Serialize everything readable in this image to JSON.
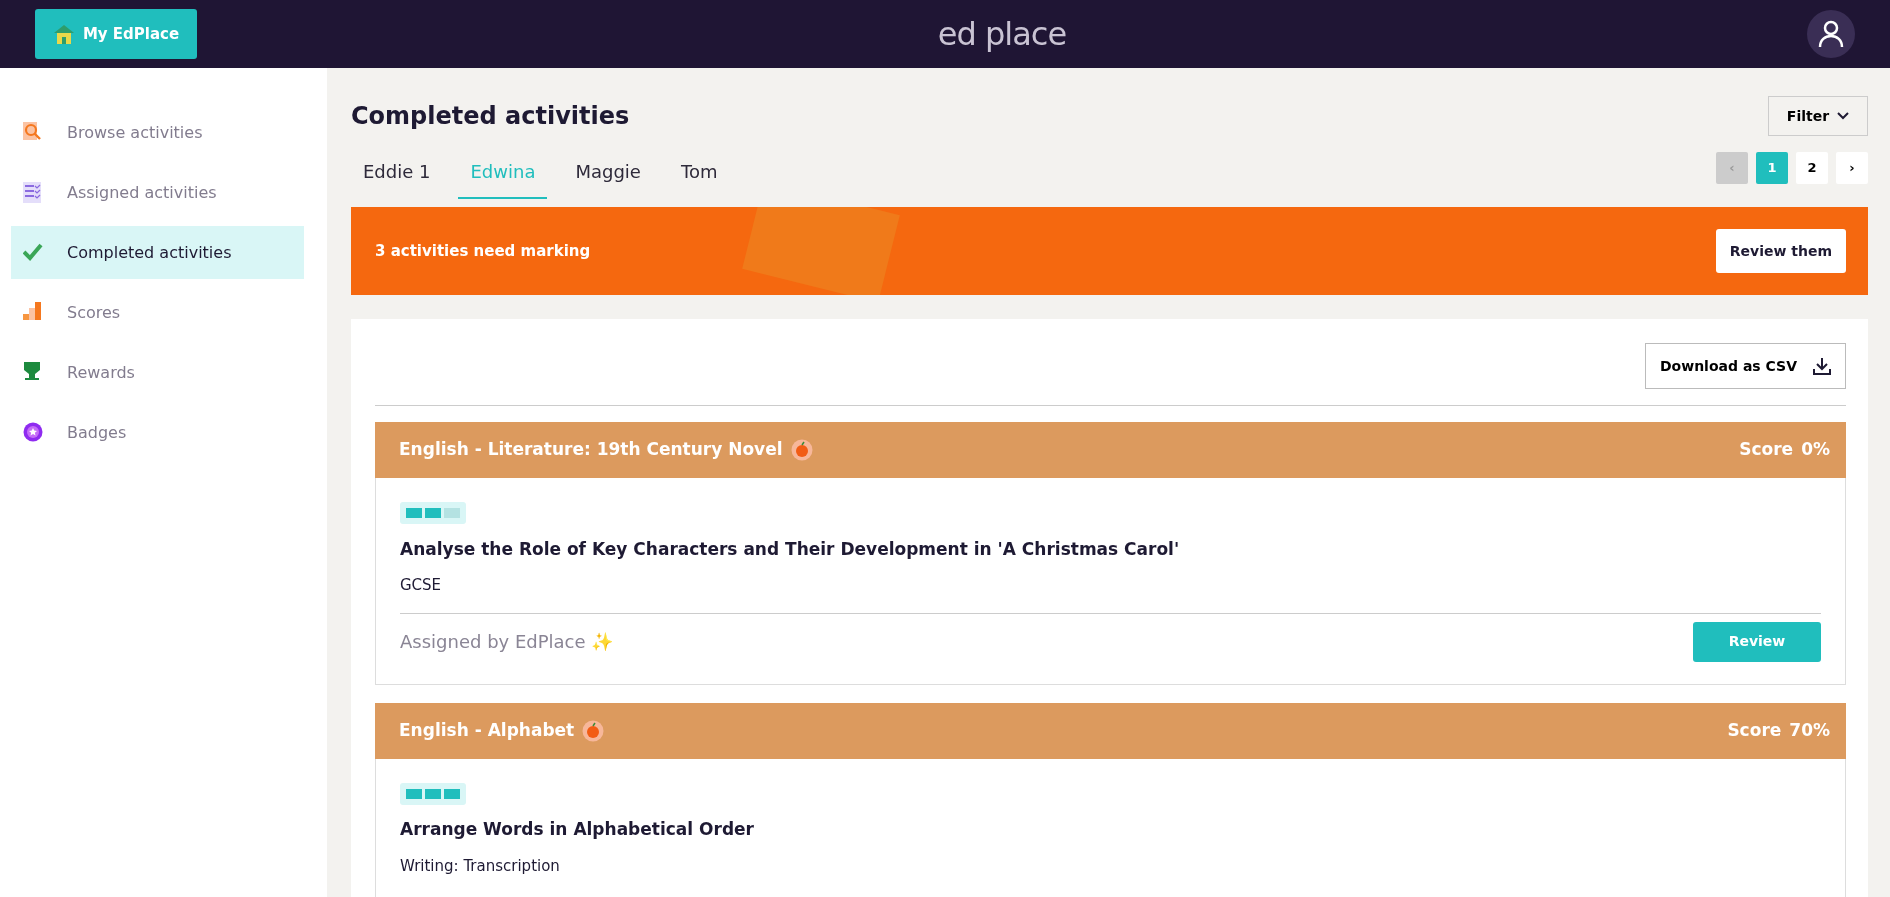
{
  "header": {
    "home_button": "My EdPlace",
    "logo": "ed place"
  },
  "sidebar": {
    "items": [
      {
        "label": "Browse activities",
        "kind": "search",
        "selected": false
      },
      {
        "label": "Assigned activities",
        "kind": "list",
        "selected": false
      },
      {
        "label": "Completed activities",
        "kind": "check",
        "selected": true
      },
      {
        "label": "Scores",
        "kind": "bars",
        "selected": false
      },
      {
        "label": "Rewards",
        "kind": "trophy",
        "selected": false
      },
      {
        "label": "Badges",
        "kind": "badge",
        "selected": false
      }
    ]
  },
  "page": {
    "title": "Completed activities",
    "filter_button": "Filter"
  },
  "tabs": [
    {
      "label": "Eddie 1",
      "selected": false
    },
    {
      "label": "Edwina",
      "selected": true
    },
    {
      "label": "Maggie",
      "selected": false
    },
    {
      "label": "Tom",
      "selected": false
    }
  ],
  "pagination": {
    "prev": "‹",
    "pages": [
      {
        "label": "1",
        "selected": true
      },
      {
        "label": "2",
        "selected": false
      }
    ],
    "next": "›"
  },
  "banner": {
    "text": "3 activities need marking",
    "button": "Review them"
  },
  "download_button": "Download as CSV",
  "activities": [
    {
      "subject": "English - Literature: 19th Century Novel",
      "score_label": "Score",
      "score": "0%",
      "stars": 2,
      "title": "Analyse the Role of Key Characters and Their Development in 'A Christmas Carol'",
      "level": "GCSE",
      "assigned_by": "Assigned by EdPlace ✨",
      "button": "Review"
    },
    {
      "subject": "English - Alphabet",
      "score_label": "Score",
      "score": "70%",
      "stars": 3,
      "title": "Arrange Words in Alphabetical Order",
      "level": "Writing: Transcription"
    }
  ]
}
